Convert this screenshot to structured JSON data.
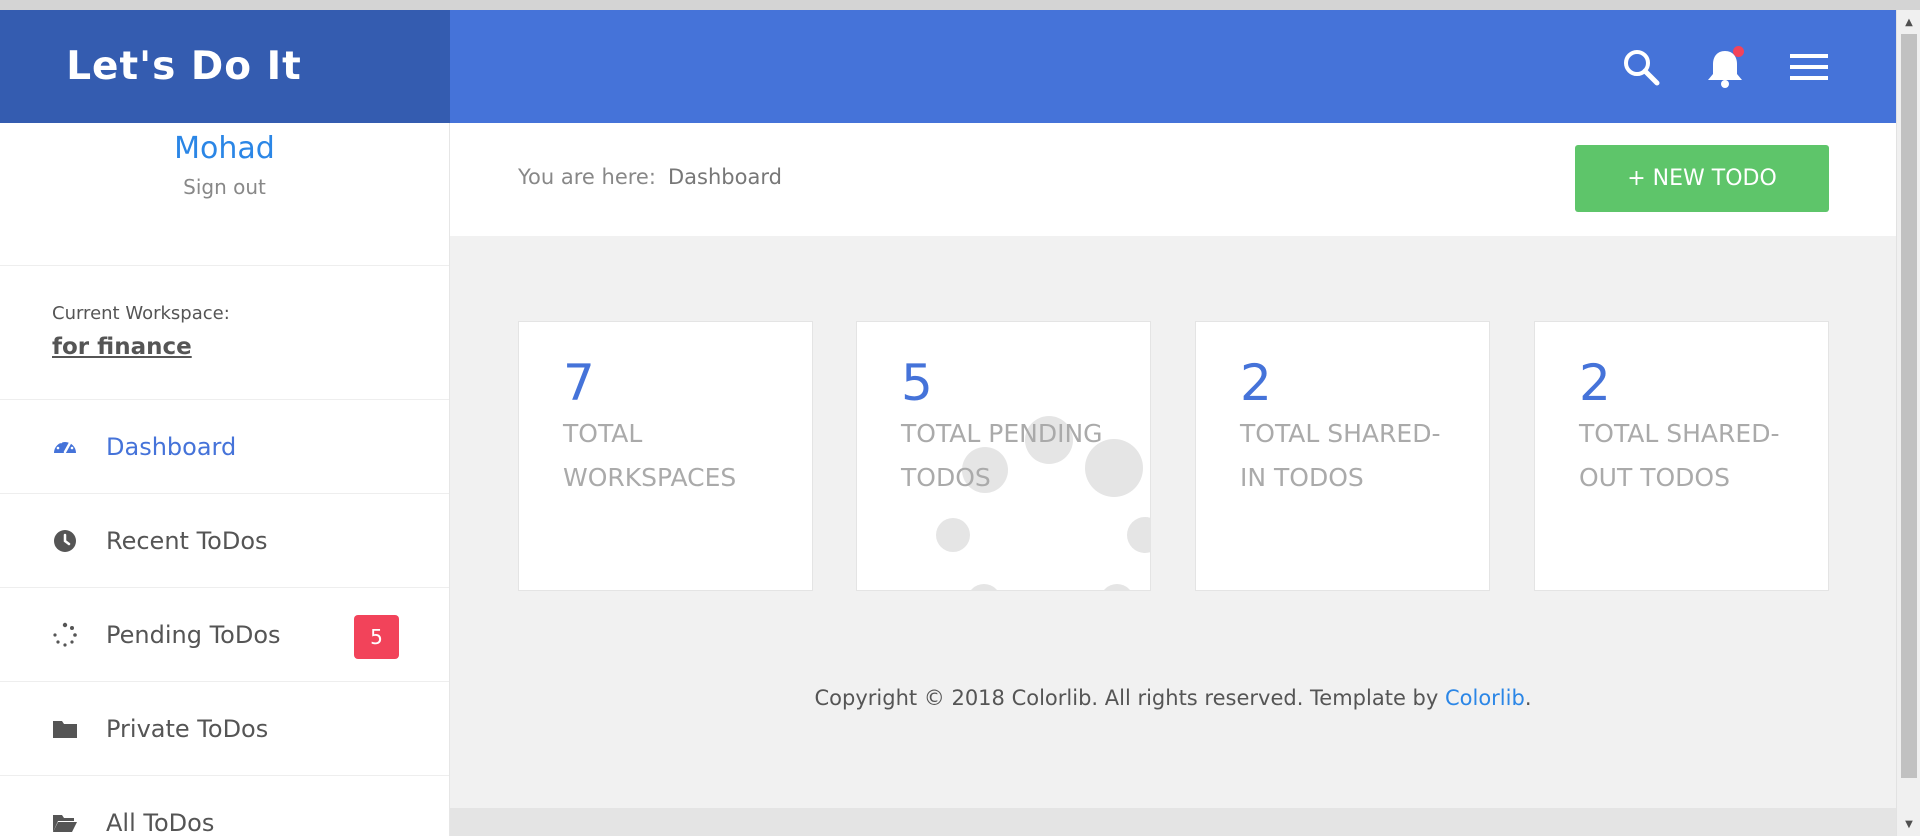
{
  "brand": {
    "title": "Let's Do It"
  },
  "topbar": {
    "icons": [
      "search-icon",
      "bell-icon",
      "hamburger-menu-icon"
    ],
    "colors": {
      "bar": "#4573d9",
      "brand": "#345cb0",
      "notification_dot": "#f2435a"
    }
  },
  "sidebar": {
    "user_name": "Mohad",
    "sign_out": "Sign out",
    "workspace_label": "Current Workspace:",
    "workspace_name": "for finance",
    "items": [
      {
        "label": "Dashboard",
        "icon": "dashboard-gauge-icon",
        "active": true
      },
      {
        "label": "Recent ToDos",
        "icon": "clock-icon"
      },
      {
        "label": "Pending ToDos",
        "icon": "spinner-icon",
        "badge": "5"
      },
      {
        "label": "Private ToDos",
        "icon": "folder-icon"
      },
      {
        "label": "All ToDos",
        "icon": "folder-open-icon"
      }
    ]
  },
  "breadcrumb": {
    "prefix": "You are here:",
    "current": "Dashboard"
  },
  "new_todo_button": "+ NEW TODO",
  "stats": [
    {
      "value": "7",
      "label": "TOTAL WORKSPACES"
    },
    {
      "value": "5",
      "label": "TOTAL PENDING TODOS"
    },
    {
      "value": "2",
      "label": "TOTAL SHARED-IN TODOS"
    },
    {
      "value": "2",
      "label": "TOTAL SHARED-OUT TODOS"
    }
  ],
  "footer": {
    "text": "Copyright © 2018 Colorlib. All rights reserved. Template by ",
    "link": "Colorlib",
    "suffix": "."
  },
  "colors": {
    "accent": "#4573d9",
    "button_green": "#5ec56a",
    "badge_red": "#f2435a",
    "link_blue": "#2b86e6"
  }
}
